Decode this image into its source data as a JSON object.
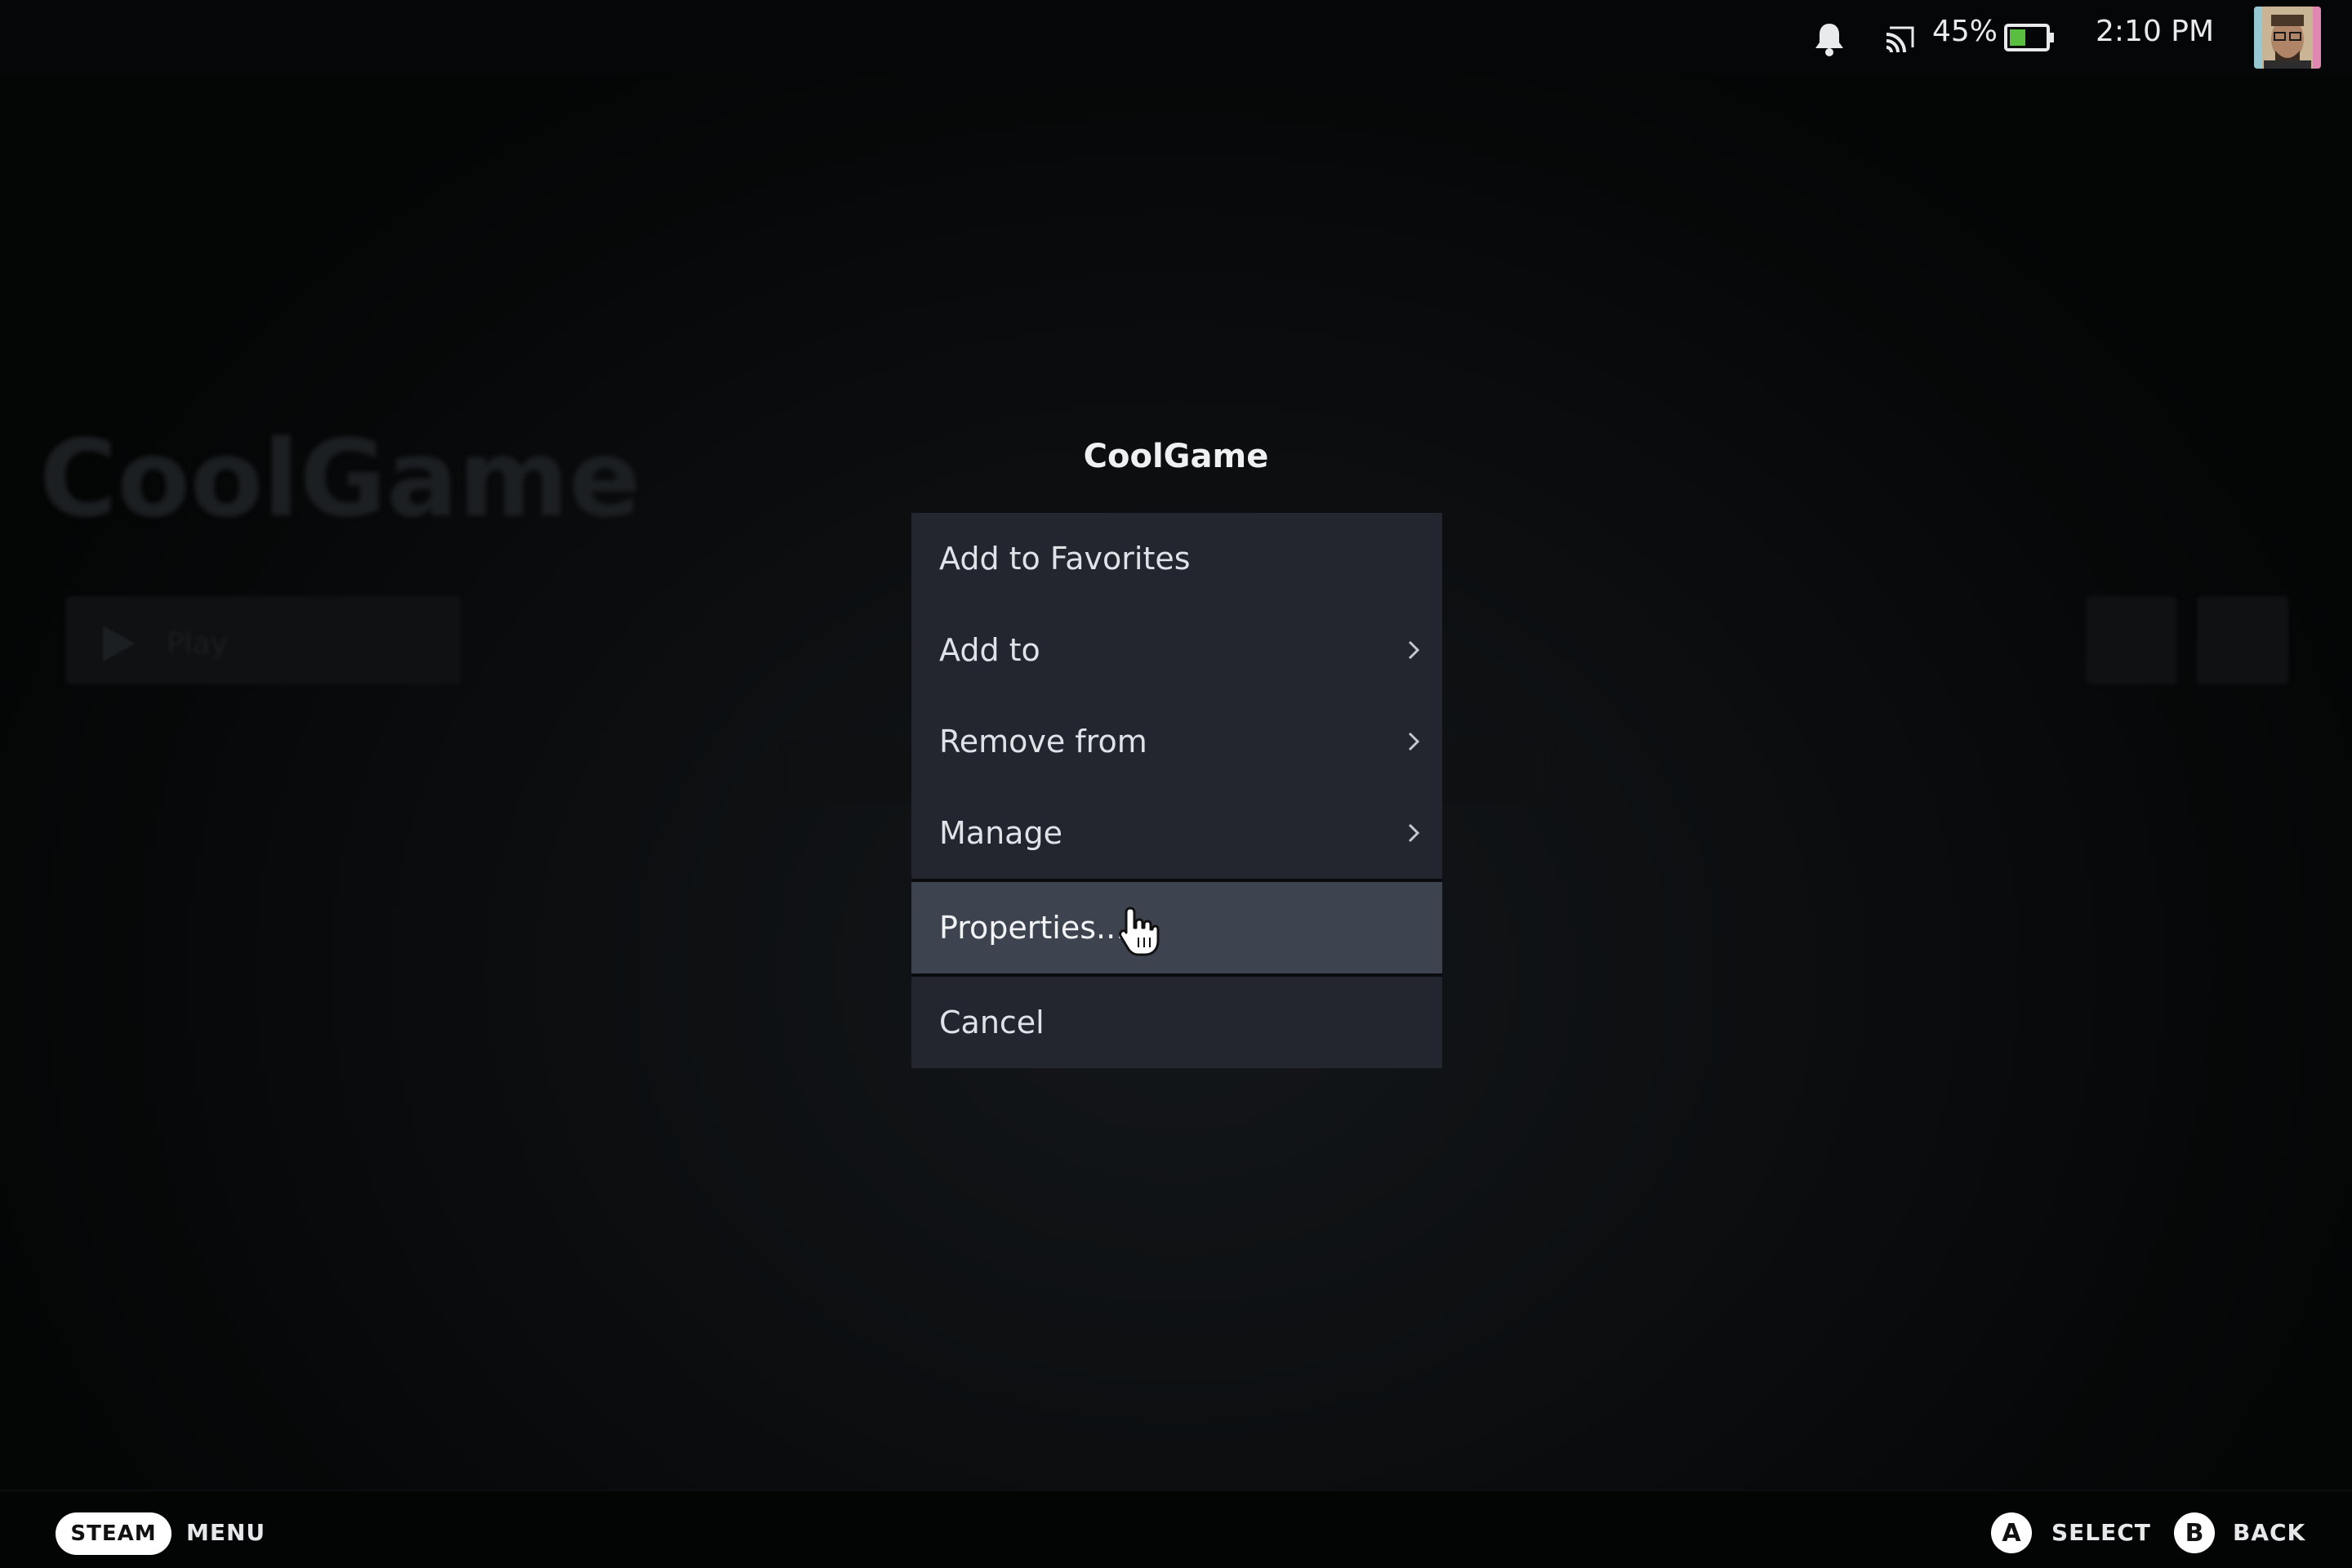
{
  "status_bar": {
    "battery_percent": "45%",
    "battery_level": 0.45,
    "time": "2:10 PM",
    "icons": [
      "bell-icon",
      "cast-icon",
      "battery-icon"
    ]
  },
  "background": {
    "game_title": "CoolGame",
    "play_label": "Play"
  },
  "context_menu": {
    "title": "CoolGame",
    "items": [
      {
        "label": "Add to Favorites",
        "submenu": false
      },
      {
        "label": "Add to",
        "submenu": true
      },
      {
        "label": "Remove from",
        "submenu": true
      },
      {
        "label": "Manage",
        "submenu": true
      },
      {
        "label": "Properties...",
        "submenu": false,
        "focused": true
      },
      {
        "label": "Cancel",
        "submenu": false
      }
    ]
  },
  "footer": {
    "steam_label": "STEAM",
    "menu_label": "MENU",
    "a_glyph": "A",
    "select_label": "SELECT",
    "b_glyph": "B",
    "back_label": "BACK"
  },
  "colors": {
    "menu_item_bg": "#23262e",
    "menu_item_focused_bg": "#3e4350",
    "battery_fill": "#59bf40"
  }
}
